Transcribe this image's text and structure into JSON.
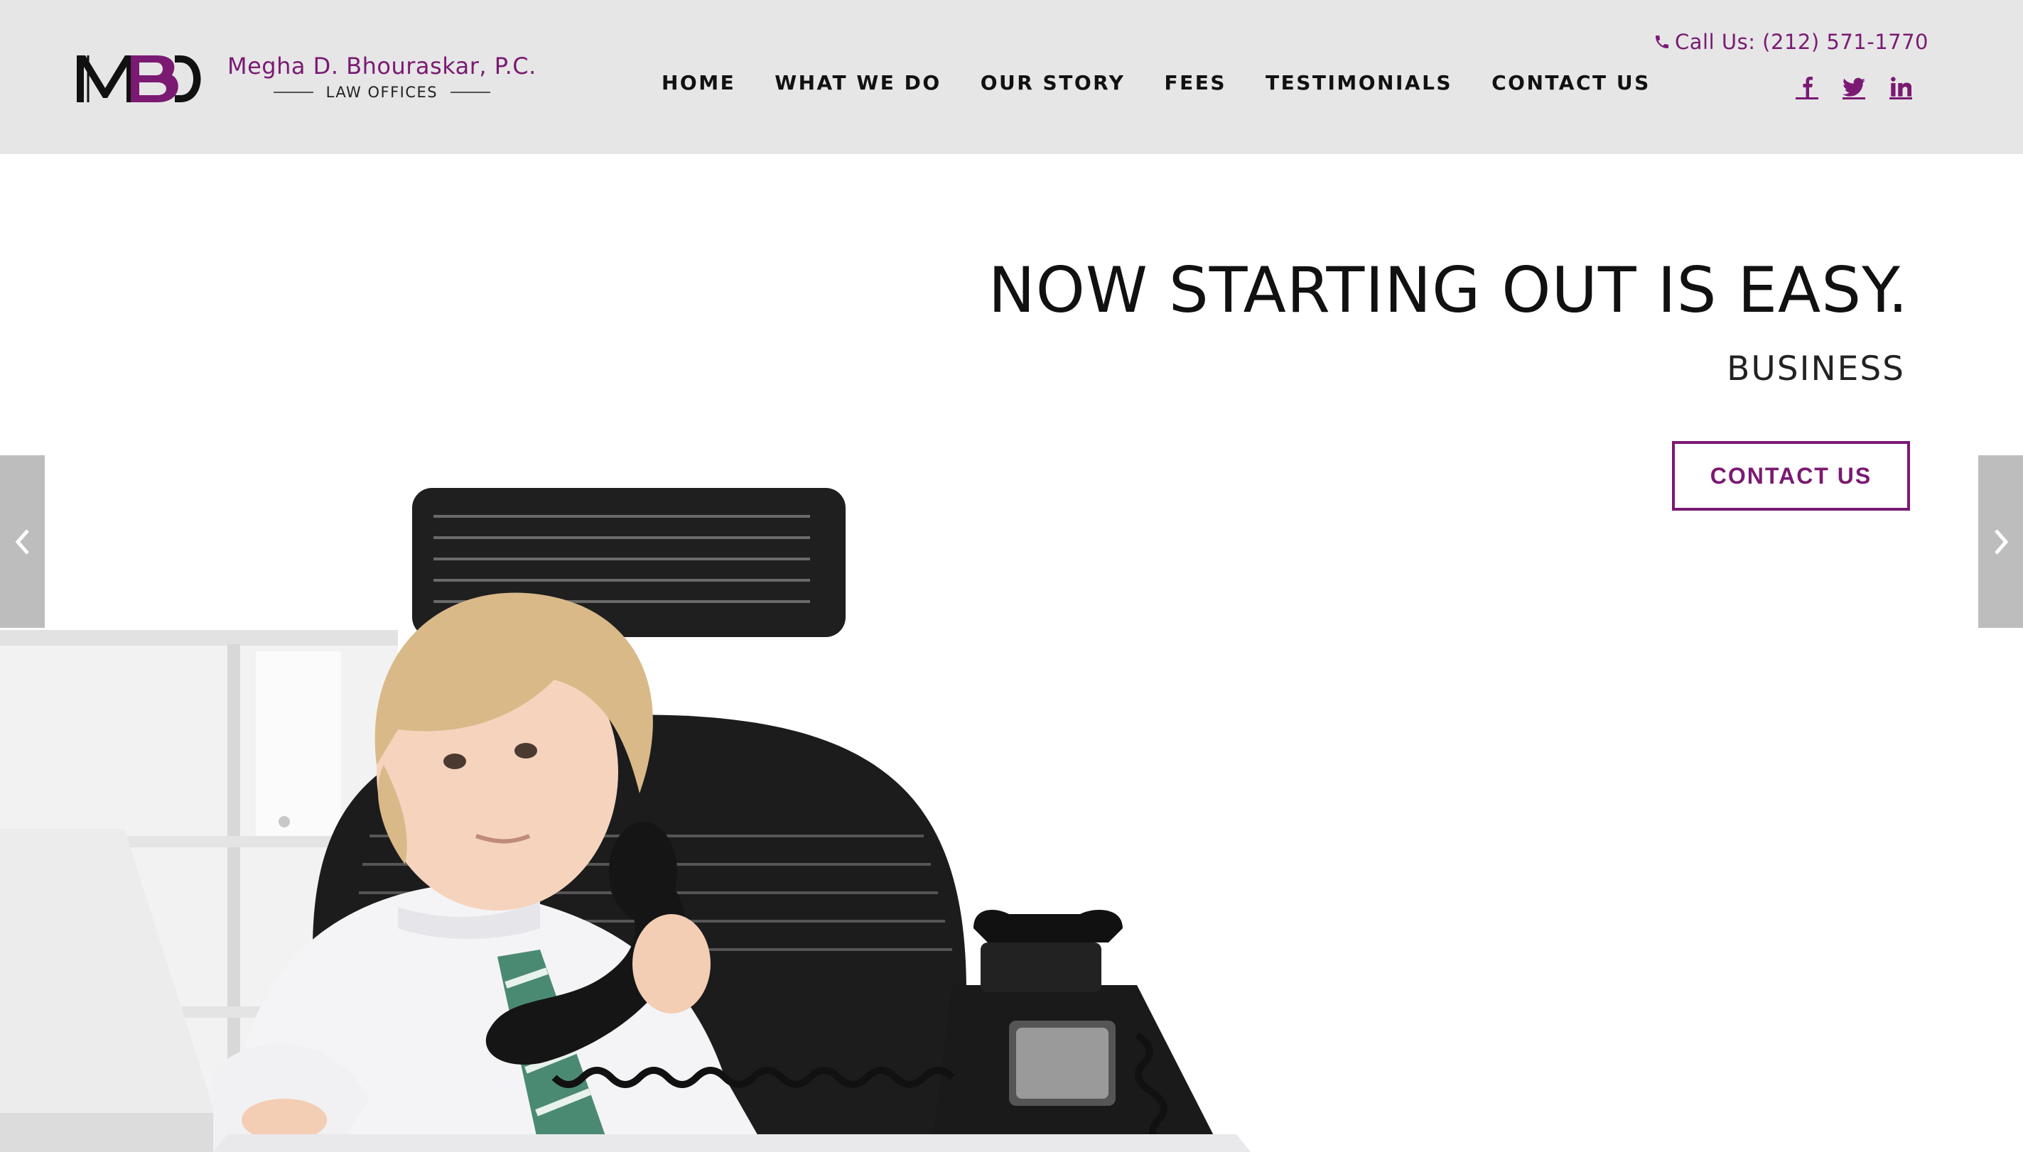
{
  "brand": {
    "monogram": "MBD",
    "name": "Megha D. Bhouraskar, P.C.",
    "subtitle": "LAW OFFICES",
    "accent_color": "#7a1a72"
  },
  "nav": {
    "items": [
      {
        "label": "HOME"
      },
      {
        "label": "WHAT WE DO"
      },
      {
        "label": "OUR STORY"
      },
      {
        "label": "FEES"
      },
      {
        "label": "TESTIMONIALS"
      },
      {
        "label": "CONTACT US"
      }
    ]
  },
  "contact": {
    "call_label": "Call Us: (212) 571-1770",
    "icon": "phone-icon"
  },
  "social": {
    "icons": [
      "facebook-icon",
      "twitter-icon",
      "linkedin-icon"
    ]
  },
  "hero": {
    "headline": "NOW STARTING OUT IS EASY.",
    "subheading": "BUSINESS",
    "cta_label": "CONTACT US",
    "prev_icon": "chevron-left-icon",
    "next_icon": "chevron-right-icon"
  }
}
